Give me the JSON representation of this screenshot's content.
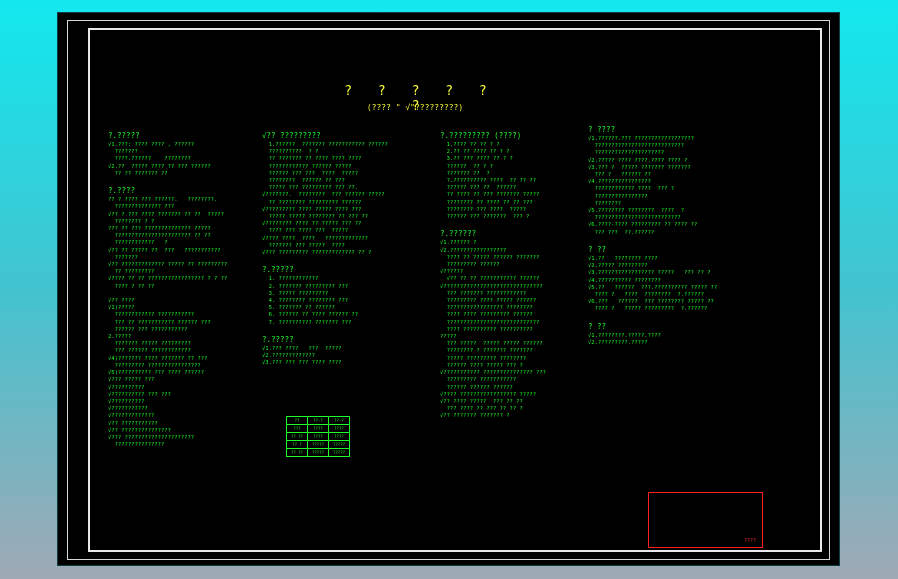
{
  "drawing": {
    "title": "? ? ? ? ? ?",
    "subtitle": "(???? \" √\"?????????)",
    "columns": [
      {
        "sections": [
          {
            "heading": "?.?????",
            "lines": [
              "√1.???: ???? ???? , ??????",
              "  ???????",
              "  ????.??????    ????????",
              "√2.??  ????? ???? ?? ??? ??????",
              "  ?? ?? ??????? ??"
            ]
          },
          {
            "heading": "?.????",
            "lines": [
              "?? ? ???? ??? ??????.   ????????.",
              "  ?????????????? ???",
              "√?? ? ??? ???? ??????? ?? ??  ?????",
              "  ???????? ? ?",
              "??? ?? ??? ?????????????? ?????",
              "  ??????????????????????? ?? ??",
              "  ????????????   ?",
              "√?? ?? ????? ??  ???   ???????????",
              "  ???????",
              "√?? ????????????? ????? ?? ?????????",
              "  ?? ?????????",
              "√???? ?? ?? ????????????????? ? ? ??",
              "  ???? ? ?? ??"
            ]
          },
          {
            "heading": "",
            "lines": [
              "√?? ????",
              "√1)?????",
              "  ???????????? ???????????",
              "  ??? ?? ??????????? ?????? ???",
              "  ?????? ??? ???????????",
              "2.?????",
              "  ??????? ????? ?????????",
              "  ??? ?????? ????????????",
              "√4)??????? ???? ??????? ?? ???",
              "  ????????? ????????????????",
              "√5)?????????? ??? ???? ??????",
              "√??? ????? ???",
              "√??????????",
              "√?????????? ??? ???",
              "√??????????",
              "√???????????",
              "√?????????????",
              "√?? ???????????",
              "√?? ???????????????",
              "√??? ?????????????????????",
              "  ???????????????"
            ]
          }
        ]
      },
      {
        "sections": [
          {
            "heading": "√?? ?????????",
            "lines": [
              "  1.??????  ??????? ??????????? ??????",
              "  ??????????  ? ?",
              "  ?? ??????? ?? ???? ???? ????",
              "  ???????????? ?????? ?????",
              "  ?????? ??? ???  ????  ?????",
              "  ????????  ?????? ?? ???",
              "  ????? ??? ????????? ??? ??.",
              "√???????.  ????????  ??? ?????? ?????",
              "  ?? ???????? ????????? ??????",
              "√????????? ???? ????? ???? ???",
              "  ????? ????? ???????? ?? ??? ??",
              "√???????? ???? ?? ????? ??? ??",
              "  ???? ??? ???? ???  ?????",
              "√???? ????  ????   ?????????????",
              "  ??????? ??? ?????  ????",
              "√??? ????????? ????????????? ?? ?"
            ]
          },
          {
            "heading": "?.?????",
            "lines": [
              "  1. ????????????",
              "  2. ??????? ????????? ???",
              "  3. ????? ?????????",
              "  4. ???????? ???????? ???",
              "  5. ??????? ?? ??????",
              "  6. ?????? ?? ???? ?????? ??",
              "  7. ?????????? ??????? ???"
            ]
          },
          {
            "heading": "?.?????",
            "lines": [
              "√1.??? ????   ???  ?????",
              "√2.?????????????",
              "√3.??? ??? ??? ???? ????"
            ]
          }
        ]
      },
      {
        "sections": [
          {
            "heading": "?.????????? (????)",
            "lines": [
              "  1.???? ?? ?? ? ?",
              "  2.?? ?? ???? ?? ? ?",
              "  3.?? ??? ???? ?? ? ?",
              "  ??????  ?? ? ?",
              "  ??????? ??  ?",
              "  ?.?????????? ????  ?? ?? ??",
              "  ?????? ??? ??  ??????",
              "  ?? ???? ?? ??? ??????? ?????",
              "  ???????? ?? ???? ?? ?? ???",
              "  ???????? ??? ????  ?????",
              "  ?????? ??? ???????  ??? ?"
            ]
          },
          {
            "heading": "?.??????",
            "lines": [
              "√1.?????? ?",
              "√2.?????????????????",
              "  ???? ?? ????? ?????? ???????",
              "  ????????? ??????",
              "√??????",
              "  √?? ?? ?? ??????????? ??????",
              "√??????????????????????????????",
              "  ??? ??????? ????????????",
              "  ????????? ???? ????? ??????",
              "  ????????????????? ????????",
              "  ???? ???? ????????? ??????",
              "  ????????????????????????????",
              "  ???? ?????????? ??????????",
              "?????",
              "  ??? ?????  ????? ????? ??????",
              "  ???????? ? ??????? ???????",
              "  ????? ????????? ????????",
              "  ?????? ???? ????? ??? ?",
              "√??????????? ??????????????? ???",
              "  ????????? ???????????",
              "  ?????? ?????? ??????",
              "√???? ????????????????? ?????",
              "√?? ???? ?????  ??? ?? ??",
              "  ??? ???? ?? ??? ?? ?? ?",
              "√?? ??????? ??????? ?"
            ]
          }
        ]
      },
      {
        "sections": [
          {
            "heading": "? ????",
            "lines": [
              "√1.??????.??? ??????????????????",
              "  ???????????????????????????",
              "  ?????????????????????",
              "√2.????? ???? ????.???? ???? ?",
              "√3.??? ?  ????? ??????? ???????",
              "  ??? ?   ?????? ??",
              "√4.????????????????",
              "  ???????????? ????  ??? ?",
              "  ????????????????",
              "  ????????",
              "√5.???????? ????????  ????  ?",
              "  ??????????????????????????",
              "√6.????-???? ????????? ?? ???? ??",
              "  ??? ???  ??.??????"
            ]
          },
          {
            "heading": "? ??",
            "lines": [
              "√1.??   ???????? ????",
              "√2.????? ?????????",
              "√3.????????????????? ?????   ??? ?? ?",
              "√4.?????????? ????????",
              "√5.??   ??????  ???.?????????? ????? ??",
              "  ???? ?   ????  ????????  ?.??????",
              "√6.???   ??????  ??? ???????? ????? ??",
              "  ???? ?   ????? ?????????  ?.??????"
            ]
          },
          {
            "heading": "? ??",
            "lines": [
              "√1.????????.?????.????",
              "√2.?????????.?????"
            ]
          }
        ]
      }
    ],
    "spec_table": [
      [
        "??",
        "??-?",
        "??-?"
      ],
      [
        "???",
        "????",
        "????"
      ],
      [
        "?? ??",
        "????",
        "????"
      ],
      [
        "?? ?",
        "?????",
        "?????"
      ],
      [
        "?? ??",
        "?????",
        "?????"
      ]
    ],
    "title_block_mark": "????",
    "colors": {
      "text": "#1bff2a",
      "title": "#ffff33",
      "title_block": "#ff2020",
      "frame": "#e8e8e8",
      "sheet": "#000000"
    }
  }
}
